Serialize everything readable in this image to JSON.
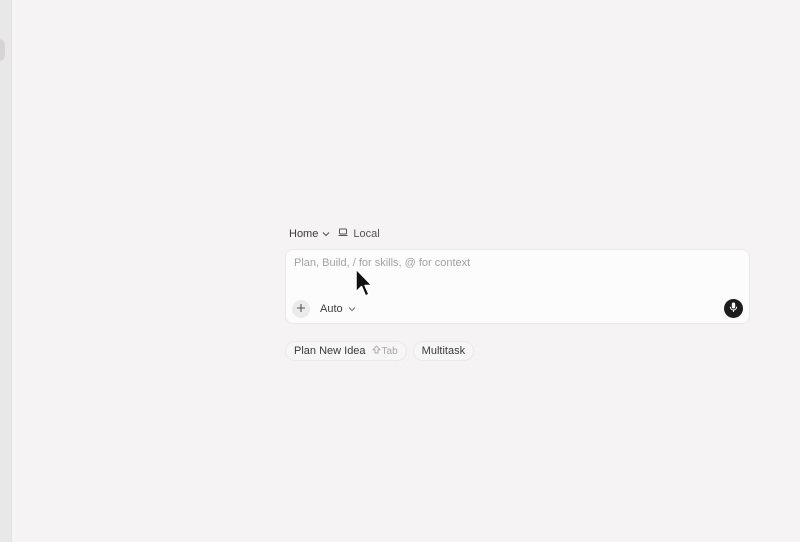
{
  "context": {
    "workspace_label": "Home",
    "location_label": "Local"
  },
  "composer": {
    "value": "",
    "placeholder": "Plan, Build, / for skills, @ for context",
    "mode_label": "Auto"
  },
  "chips": [
    {
      "label": "Plan New Idea",
      "hint": "Tab"
    },
    {
      "label": "Multitask"
    }
  ],
  "icons": {
    "workspace_dropdown": "chevron-down-icon",
    "location": "laptop-icon",
    "add": "plus-icon",
    "mode_dropdown": "chevron-down-icon",
    "mic": "microphone-icon",
    "hint_key": "shift-icon"
  },
  "colors": {
    "background": "#f5f3f4",
    "input_background": "#fdfcfd",
    "mic_button": "#1d1d1d"
  }
}
